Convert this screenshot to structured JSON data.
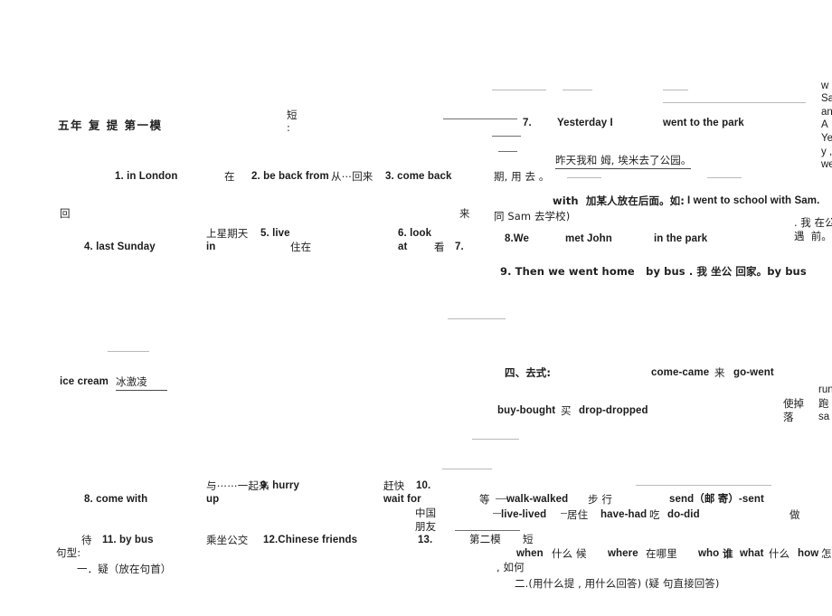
{
  "document": {
    "title": "五年 复 提 第一模",
    "section_marker": "短",
    "section_marker_colon": ":"
  },
  "vocab_block_one": {
    "item1": "1. in London",
    "item1_gloss": "在",
    "item2": "2. be back from",
    "item2_gloss": "从⋯回来",
    "item3": "3. come back",
    "item3_gloss": "回",
    "item3_gloss2": "来",
    "item4": "4. last Sunday",
    "item4_gloss": "上星期天",
    "item5": "5. live in",
    "item5_gloss": "住在",
    "item6": "6. look at",
    "item6_gloss": "看",
    "item7_num": "7."
  },
  "example_block": {
    "line7_num": "7.",
    "line7_en_a": "Yesterday I",
    "line7_en_b": "went to the park",
    "line7_cn": "昨天我和 姆, 埃米去了公园。",
    "note_period": "期, 用 去 。",
    "with_note_cn": "with  加某人放在后面。如:",
    "with_note_en": "I went to school with Sam.",
    "with_note_cn2": "同 Sam 去学校)",
    "line8_num": "8.We",
    "line8_en_a": "met John",
    "line8_en_b": "in the park",
    "line8_cn_a": ". 我 在公",
    "line8_cn_b": "遇  前。",
    "line9": "9. Then we went home   by bus . 我 坐公 回家。by bus"
  },
  "clipped_right_top": {
    "lines": [
      "w",
      "Sa",
      "an",
      "A",
      "Ye",
      "y ,",
      "we"
    ]
  },
  "clipped_right_verbs": {
    "lines": [
      "run",
      "跑",
      "sa"
    ]
  },
  "ice_cream": {
    "en": "ice cream",
    "cn": "冰激凌"
  },
  "past_tense_section": {
    "heading": "四、去式:",
    "pair1": "come-came",
    "pair1_gloss": "来",
    "pair2": "go-went",
    "pair3": "buy-bought",
    "pair3_gloss": "买",
    "pair4": "drop-dropped",
    "gloss_shidiao": "使掉",
    "gloss_luo": "落",
    "pair5": "walk-walked",
    "pair5_gloss": "步 行",
    "pair6": "send（邮 寄）-sent",
    "pair7": "live-lived",
    "pair7_gloss": "居住",
    "pair8": "have-had",
    "pair8_gloss": "吃",
    "pair9": "do-did",
    "pair9_gloss": "做",
    "deng": "等"
  },
  "vocab_block_two": {
    "item8": "8. come with",
    "item8_gloss": "与⋯⋯一起来",
    "item9": "9. hurry up",
    "item9_gloss": "赶快",
    "item10": "10. wait for",
    "item10_gloss": "待",
    "item11": "11. by bus",
    "item11_gloss": "乘坐公交",
    "item12": "12.Chinese friends",
    "item12_gloss_a": "中国",
    "item12_gloss_b": "朋友",
    "item13": "13."
  },
  "module_two": {
    "heading": "第二模",
    "marker": "短",
    "q_when": "when",
    "q_when_gloss": "什么 候",
    "q_where": "where",
    "q_where_gloss": "在哪里",
    "q_who": "who",
    "q_who_gloss": "谁",
    "q_what": "what",
    "q_what_gloss": "什么",
    "q_how": "how",
    "q_how_gloss": "怎",
    "q_how_gloss2": ", 如何",
    "rule_two": "二.(用什么提 , 用什么回答) (疑 句直接回答)"
  },
  "sentence_patterns": {
    "label": "句型:",
    "rule_one": "一．疑（放在句首）"
  }
}
